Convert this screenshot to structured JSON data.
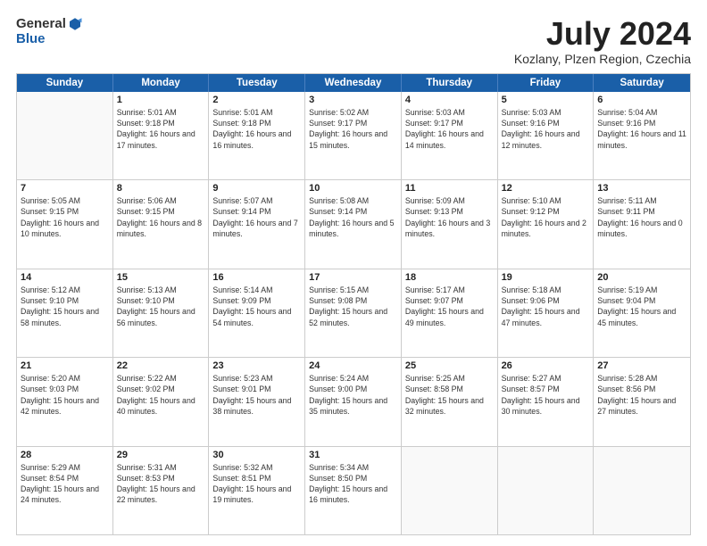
{
  "header": {
    "logo": {
      "text_general": "General",
      "text_blue": "Blue"
    },
    "title": "July 2024",
    "subtitle": "Kozlany, Plzen Region, Czechia"
  },
  "calendar": {
    "days_of_week": [
      "Sunday",
      "Monday",
      "Tuesday",
      "Wednesday",
      "Thursday",
      "Friday",
      "Saturday"
    ],
    "weeks": [
      [
        {
          "day": "",
          "empty": true
        },
        {
          "day": "1",
          "sunrise": "5:01 AM",
          "sunset": "9:18 PM",
          "daylight": "16 hours and 17 minutes."
        },
        {
          "day": "2",
          "sunrise": "5:01 AM",
          "sunset": "9:18 PM",
          "daylight": "16 hours and 16 minutes."
        },
        {
          "day": "3",
          "sunrise": "5:02 AM",
          "sunset": "9:17 PM",
          "daylight": "16 hours and 15 minutes."
        },
        {
          "day": "4",
          "sunrise": "5:03 AM",
          "sunset": "9:17 PM",
          "daylight": "16 hours and 14 minutes."
        },
        {
          "day": "5",
          "sunrise": "5:03 AM",
          "sunset": "9:16 PM",
          "daylight": "16 hours and 12 minutes."
        },
        {
          "day": "6",
          "sunrise": "5:04 AM",
          "sunset": "9:16 PM",
          "daylight": "16 hours and 11 minutes."
        }
      ],
      [
        {
          "day": "7",
          "sunrise": "5:05 AM",
          "sunset": "9:15 PM",
          "daylight": "16 hours and 10 minutes."
        },
        {
          "day": "8",
          "sunrise": "5:06 AM",
          "sunset": "9:15 PM",
          "daylight": "16 hours and 8 minutes."
        },
        {
          "day": "9",
          "sunrise": "5:07 AM",
          "sunset": "9:14 PM",
          "daylight": "16 hours and 7 minutes."
        },
        {
          "day": "10",
          "sunrise": "5:08 AM",
          "sunset": "9:14 PM",
          "daylight": "16 hours and 5 minutes."
        },
        {
          "day": "11",
          "sunrise": "5:09 AM",
          "sunset": "9:13 PM",
          "daylight": "16 hours and 3 minutes."
        },
        {
          "day": "12",
          "sunrise": "5:10 AM",
          "sunset": "9:12 PM",
          "daylight": "16 hours and 2 minutes."
        },
        {
          "day": "13",
          "sunrise": "5:11 AM",
          "sunset": "9:11 PM",
          "daylight": "16 hours and 0 minutes."
        }
      ],
      [
        {
          "day": "14",
          "sunrise": "5:12 AM",
          "sunset": "9:10 PM",
          "daylight": "15 hours and 58 minutes."
        },
        {
          "day": "15",
          "sunrise": "5:13 AM",
          "sunset": "9:10 PM",
          "daylight": "15 hours and 56 minutes."
        },
        {
          "day": "16",
          "sunrise": "5:14 AM",
          "sunset": "9:09 PM",
          "daylight": "15 hours and 54 minutes."
        },
        {
          "day": "17",
          "sunrise": "5:15 AM",
          "sunset": "9:08 PM",
          "daylight": "15 hours and 52 minutes."
        },
        {
          "day": "18",
          "sunrise": "5:17 AM",
          "sunset": "9:07 PM",
          "daylight": "15 hours and 49 minutes."
        },
        {
          "day": "19",
          "sunrise": "5:18 AM",
          "sunset": "9:06 PM",
          "daylight": "15 hours and 47 minutes."
        },
        {
          "day": "20",
          "sunrise": "5:19 AM",
          "sunset": "9:04 PM",
          "daylight": "15 hours and 45 minutes."
        }
      ],
      [
        {
          "day": "21",
          "sunrise": "5:20 AM",
          "sunset": "9:03 PM",
          "daylight": "15 hours and 42 minutes."
        },
        {
          "day": "22",
          "sunrise": "5:22 AM",
          "sunset": "9:02 PM",
          "daylight": "15 hours and 40 minutes."
        },
        {
          "day": "23",
          "sunrise": "5:23 AM",
          "sunset": "9:01 PM",
          "daylight": "15 hours and 38 minutes."
        },
        {
          "day": "24",
          "sunrise": "5:24 AM",
          "sunset": "9:00 PM",
          "daylight": "15 hours and 35 minutes."
        },
        {
          "day": "25",
          "sunrise": "5:25 AM",
          "sunset": "8:58 PM",
          "daylight": "15 hours and 32 minutes."
        },
        {
          "day": "26",
          "sunrise": "5:27 AM",
          "sunset": "8:57 PM",
          "daylight": "15 hours and 30 minutes."
        },
        {
          "day": "27",
          "sunrise": "5:28 AM",
          "sunset": "8:56 PM",
          "daylight": "15 hours and 27 minutes."
        }
      ],
      [
        {
          "day": "28",
          "sunrise": "5:29 AM",
          "sunset": "8:54 PM",
          "daylight": "15 hours and 24 minutes."
        },
        {
          "day": "29",
          "sunrise": "5:31 AM",
          "sunset": "8:53 PM",
          "daylight": "15 hours and 22 minutes."
        },
        {
          "day": "30",
          "sunrise": "5:32 AM",
          "sunset": "8:51 PM",
          "daylight": "15 hours and 19 minutes."
        },
        {
          "day": "31",
          "sunrise": "5:34 AM",
          "sunset": "8:50 PM",
          "daylight": "15 hours and 16 minutes."
        },
        {
          "day": "",
          "empty": true
        },
        {
          "day": "",
          "empty": true
        },
        {
          "day": "",
          "empty": true
        }
      ]
    ]
  }
}
